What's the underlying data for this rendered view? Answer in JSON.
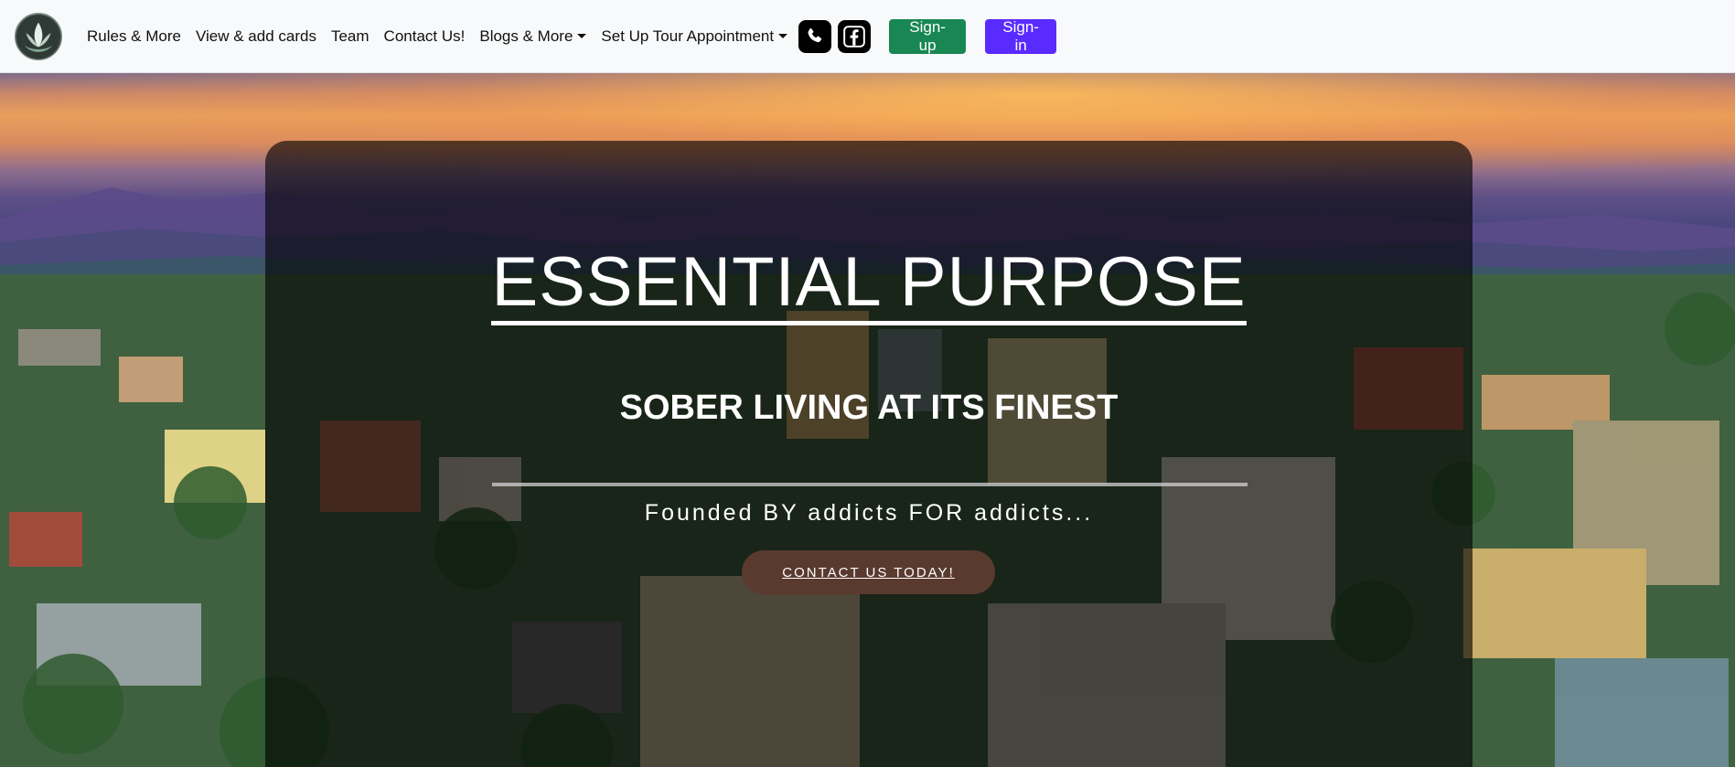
{
  "nav": {
    "logo": "site-logo",
    "links": [
      {
        "label": "Rules & More",
        "dropdown": false
      },
      {
        "label": "View & add cards",
        "dropdown": false
      },
      {
        "label": "Team",
        "dropdown": false
      },
      {
        "label": "Contact Us!",
        "dropdown": false
      },
      {
        "label": "Blogs & More",
        "dropdown": true
      },
      {
        "label": "Set Up Tour Appointment",
        "dropdown": true
      }
    ],
    "icons": [
      "phone-icon",
      "facebook-icon"
    ],
    "signup_label": "Sign-up",
    "signin_label": "Sign-in"
  },
  "hero": {
    "title": "ESSENTIAL PURPOSE",
    "subtitle": "SOBER LIVING AT ITS FINEST",
    "tagline": "Founded BY addicts FOR addicts...",
    "cta_label": "CONTACT US TODAY!"
  },
  "colors": {
    "navbar_bg": "#f8f9fa",
    "signup_bg": "#198754",
    "signin_bg": "#5a2bff",
    "cta_bg": "#5a3a2e",
    "overlay": "rgba(0,0,0,0.62)"
  }
}
